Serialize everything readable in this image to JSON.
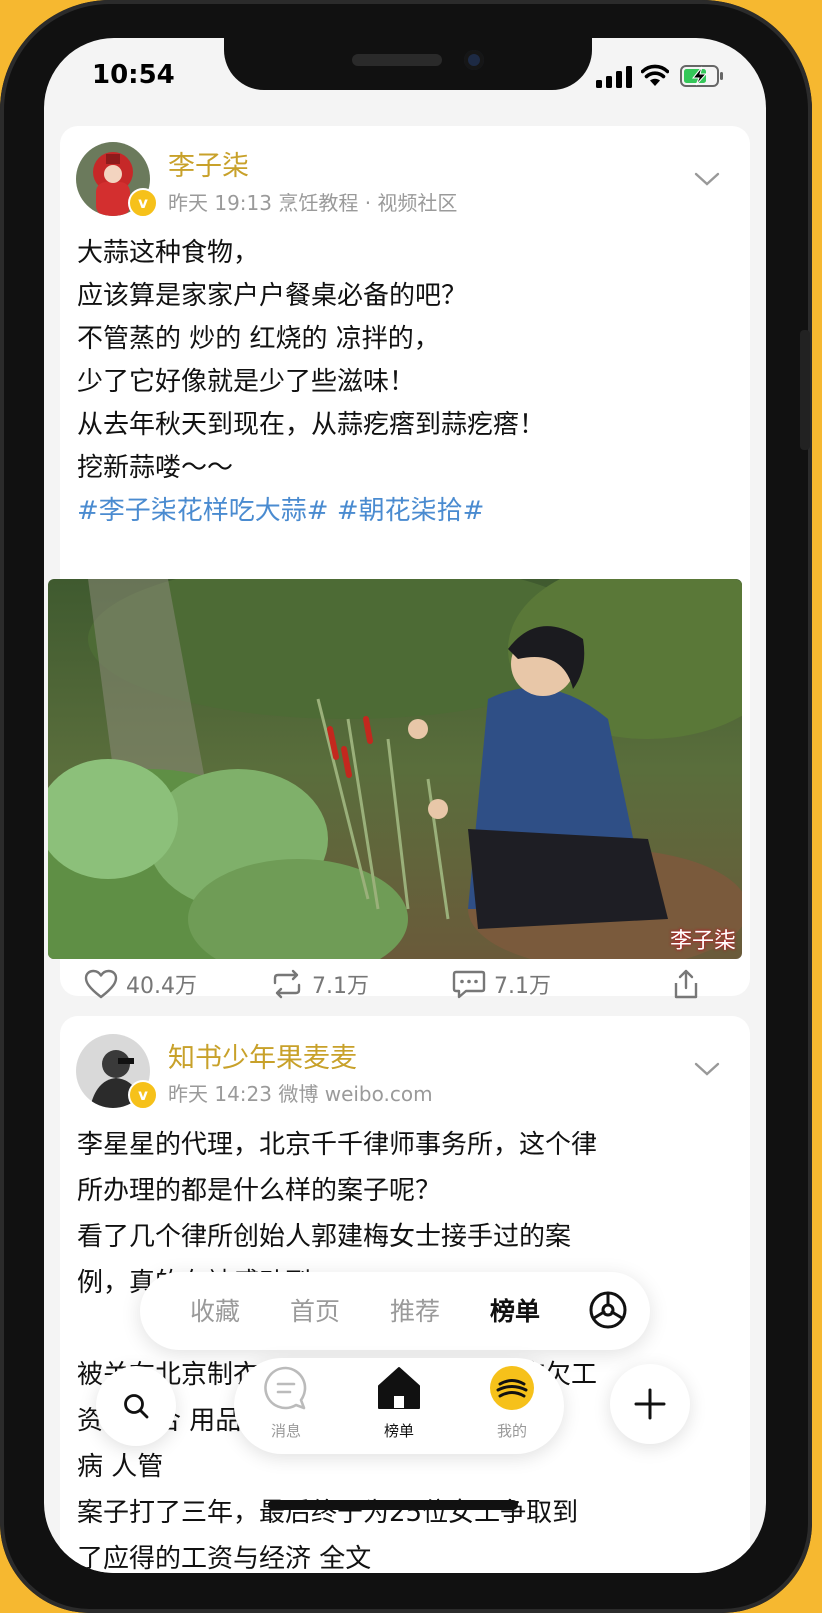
{
  "status": {
    "time": "10:54"
  },
  "post1": {
    "username": "李子柒",
    "meta": "昨天 19:13  烹饪教程 · 视频社区",
    "lines": [
      "大蒜这种食物，",
      "应该算是家家户户餐桌必备的吧？",
      "不管蒸的  炒的 红烧的 凉拌的，",
      "少了它好像就是少了些滋味！",
      "从去年秋天到现在，从蒜疙瘩到蒜疙瘩！",
      "挖新蒜喽～～"
    ],
    "tags": "#李子柒花样吃大蒜# #朝花柒拾#",
    "watermark": "李子柒",
    "likes": "40.4万",
    "reposts": "7.1万",
    "comments": "7.1万"
  },
  "post2": {
    "username": "知书少年果麦麦",
    "meta": "昨天 14:23  微博 weibo.com",
    "lines": [
      "李星星的代理，北京千千律师事务所，这个律",
      "所办理的都是什么样的案子呢？",
      "看了几个律所创始人郭建梅女士接手过的案",
      "例，真的有被感动到："
    ],
    "lines_lower": [
      "被关在北京制衣厂打工的女工，被长期拖欠工",
      "资，有合          用品       了",
      "病      人管",
      "案子打了三年，最后终于为25位女工争取到",
      "了应得的工资与经济    全文"
    ]
  },
  "feed_nav": {
    "items": [
      "收藏",
      "首页",
      "推荐",
      "榜单"
    ],
    "active": 3
  },
  "tabbar": {
    "messages": "消息",
    "ranking": "榜单",
    "me": "我的"
  },
  "colors": {
    "username": "#c8a12a",
    "hashtag": "#4a8bd0",
    "background": "#f6b830"
  }
}
